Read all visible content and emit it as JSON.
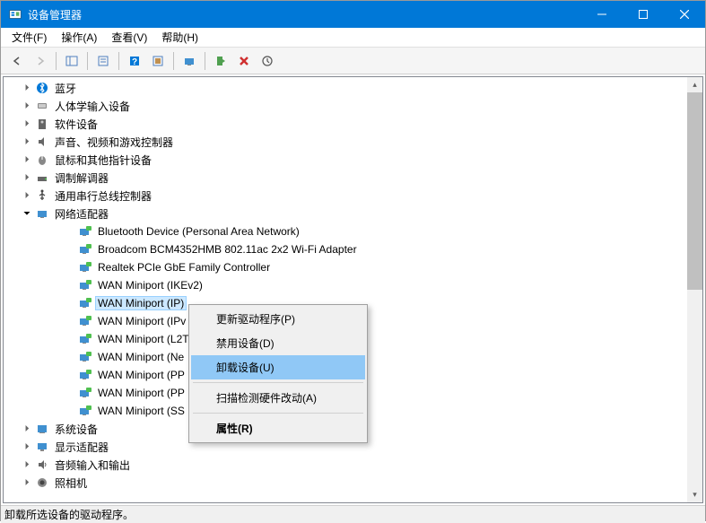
{
  "window": {
    "title": "设备管理器"
  },
  "menu": {
    "file": "文件(F)",
    "action": "操作(A)",
    "view": "查看(V)",
    "help": "帮助(H)"
  },
  "tree": {
    "categories": [
      {
        "label": "蓝牙",
        "icon": "bluetooth"
      },
      {
        "label": "人体学输入设备",
        "icon": "hid"
      },
      {
        "label": "软件设备",
        "icon": "software"
      },
      {
        "label": "声音、视频和游戏控制器",
        "icon": "sound"
      },
      {
        "label": "鼠标和其他指针设备",
        "icon": "mouse"
      },
      {
        "label": "调制解调器",
        "icon": "modem"
      },
      {
        "label": "通用串行总线控制器",
        "icon": "usb"
      }
    ],
    "network": {
      "label": "网络适配器",
      "devices": [
        "Bluetooth Device (Personal Area Network)",
        "Broadcom BCM4352HMB 802.11ac 2x2 Wi-Fi Adapter",
        "Realtek PCIe GbE Family Controller",
        "WAN Miniport (IKEv2)",
        "WAN Miniport (IP)",
        "WAN Miniport (IPv",
        "WAN Miniport (L2T",
        "WAN Miniport (Ne",
        "WAN Miniport (PP",
        "WAN Miniport (PP",
        "WAN Miniport (SS"
      ],
      "selected_index": 4
    },
    "after": [
      {
        "label": "系统设备",
        "icon": "system"
      },
      {
        "label": "显示适配器",
        "icon": "display"
      },
      {
        "label": "音频输入和输出",
        "icon": "audio"
      },
      {
        "label": "照相机",
        "icon": "camera"
      }
    ]
  },
  "context_menu": {
    "update": "更新驱动程序(P)",
    "disable": "禁用设备(D)",
    "uninstall": "卸载设备(U)",
    "scan": "扫描检测硬件改动(A)",
    "properties": "属性(R)"
  },
  "statusbar": {
    "text": "卸载所选设备的驱动程序。"
  }
}
